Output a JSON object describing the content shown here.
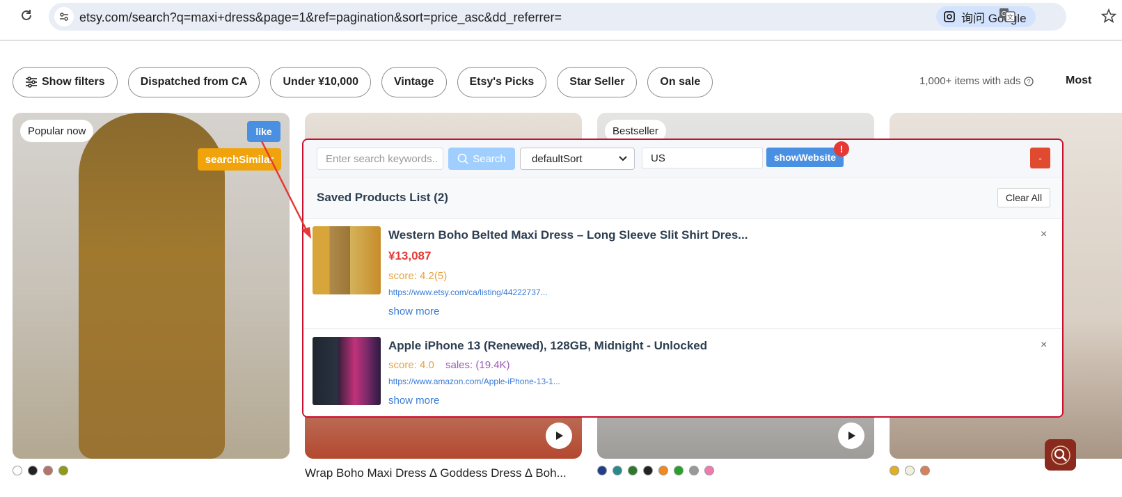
{
  "browser": {
    "url": "etsy.com/search?q=maxi+dress&page=1&ref=pagination&sort=price_asc&dd_referrer=",
    "lens_label": "询问 Google"
  },
  "filters": {
    "show_filters": "Show filters",
    "chips": [
      "Dispatched from CA",
      "Under ¥10,000",
      "Vintage",
      "Etsy's Picks",
      "Star Seller",
      "On sale"
    ],
    "items_count": "1,000+ items with ads",
    "sort_label": "Most"
  },
  "cards": {
    "card1_badge": "Popular now",
    "card3_badge": "Bestseller",
    "like_label": "like",
    "search_similar_label": "searchSimilar",
    "card2_title": "Wrap Boho Maxi Dress ∆ Goddess Dress ∆ Boh...",
    "swatches1": [
      "#ffffff",
      "#222222",
      "#b5746a",
      "#8f9a1a"
    ],
    "swatches3": [
      "#1f3f8a",
      "#2a8a8a",
      "#2a7a2a",
      "#222222",
      "#f08a20",
      "#2aa02a",
      "#999999",
      "#f07ab0"
    ],
    "swatches4": [
      "#e0b020",
      "#f0f0dc",
      "#d8805a"
    ]
  },
  "plugin": {
    "keyword_placeholder": "Enter search keywords..",
    "search_label": "Search",
    "sort_value": "defaultSort",
    "region_value": "US",
    "show_website_label": "showWebsite",
    "alert_badge": "!",
    "collapse_label": "-",
    "list_title": "Saved Products List (2)",
    "clear_all_label": "Clear All",
    "items": [
      {
        "title": "Western Boho Belted Maxi Dress – Long Sleeve Slit Shirt Dres...",
        "price": "¥13,087",
        "score": "score: 4.2(5)",
        "url": "https://www.etsy.com/ca/listing/44222737...",
        "more": "show more",
        "close": "×"
      },
      {
        "title": "Apple iPhone 13 (Renewed), 128GB, Midnight - Unlocked",
        "score": "score: 4.0",
        "sales": "sales: (19.4K)",
        "url": "https://www.amazon.com/Apple-iPhone-13-1...",
        "more": "show more",
        "close": "×"
      }
    ]
  },
  "colors": {
    "panel_border": "#c8102e",
    "like_blue": "#4a90e2",
    "search_similar_orange": "#f0a30a",
    "price_red": "#e53935",
    "score_orange": "#e6a23c",
    "sales_purple": "#9b59b6",
    "link_blue": "#3a7bd5"
  }
}
